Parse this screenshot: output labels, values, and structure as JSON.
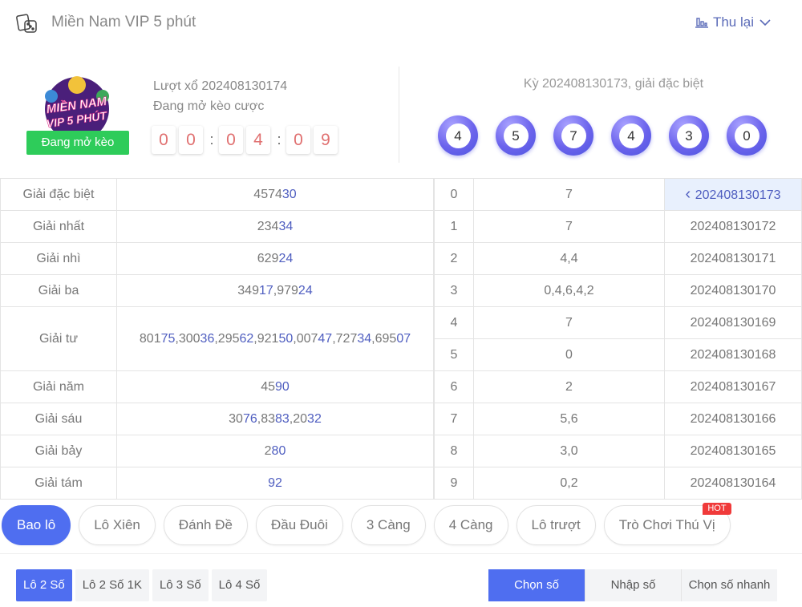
{
  "header": {
    "title": "Miền Nam VIP 5 phút",
    "history_label": "Thu lại"
  },
  "logo": {
    "text": "MIỀN NAM VIP 5 PHÚT"
  },
  "status": {
    "badge": "Đang mở kèo",
    "round": "Lượt xổ 202408130174",
    "state": "Đang mở kèo cược",
    "timer": [
      "0",
      "0",
      "0",
      "4",
      "0",
      "9"
    ]
  },
  "last": {
    "label": "Kỳ 202408130173, giải đặc biệt",
    "balls": [
      "4",
      "5",
      "7",
      "4",
      "3",
      "0"
    ]
  },
  "prizes": [
    {
      "name": "Giải đặc biệt",
      "numbers": "457430"
    },
    {
      "name": "Giải nhất",
      "numbers": "23434"
    },
    {
      "name": "Giải nhì",
      "numbers": "62924"
    },
    {
      "name": "Giải ba",
      "numbers": "34917,97924"
    },
    {
      "name": "Giải tư",
      "numbers": "80175,30036,29562,92150,00747,72734,69507"
    },
    {
      "name": "Giải năm",
      "numbers": "4590"
    },
    {
      "name": "Giải sáu",
      "numbers": "3076,8383,2032"
    },
    {
      "name": "Giải bảy",
      "numbers": "280"
    },
    {
      "name": "Giải tám",
      "numbers": "92"
    }
  ],
  "heads": [
    {
      "head": "0",
      "tails": "7",
      "period": "202408130173"
    },
    {
      "head": "1",
      "tails": "7",
      "period": "202408130172"
    },
    {
      "head": "2",
      "tails": "4,4",
      "period": "202408130171"
    },
    {
      "head": "3",
      "tails": "0,4,6,4,2",
      "period": "202408130170"
    },
    {
      "head": "4",
      "tails": "7",
      "period": "202408130169"
    },
    {
      "head": "5",
      "tails": "0",
      "period": "202408130168"
    },
    {
      "head": "6",
      "tails": "2",
      "period": "202408130167"
    },
    {
      "head": "7",
      "tails": "5,6",
      "period": "202408130166"
    },
    {
      "head": "8",
      "tails": "3,0",
      "period": "202408130165"
    },
    {
      "head": "9",
      "tails": "0,2",
      "period": "202408130164"
    }
  ],
  "game_tabs": [
    "Bao lô",
    "Lô Xiên",
    "Đánh Đề",
    "Đầu Đuôi",
    "3 Càng",
    "4 Càng",
    "Lô trượt",
    "Trò Chơi Thú Vị"
  ],
  "hot_label": "HOT",
  "sub_tabs": [
    "Lô 2 Số",
    "Lô 2 Số 1K",
    "Lô 3 Số",
    "Lô 4 Số"
  ],
  "modes": [
    "Chọn số",
    "Nhập số",
    "Chọn số nhanh"
  ],
  "colors": {
    "accent": "#4f6ef0",
    "badge": "#2ecc5a",
    "number_highlight": "#4f5ec0",
    "hot": "#f03a3a"
  }
}
